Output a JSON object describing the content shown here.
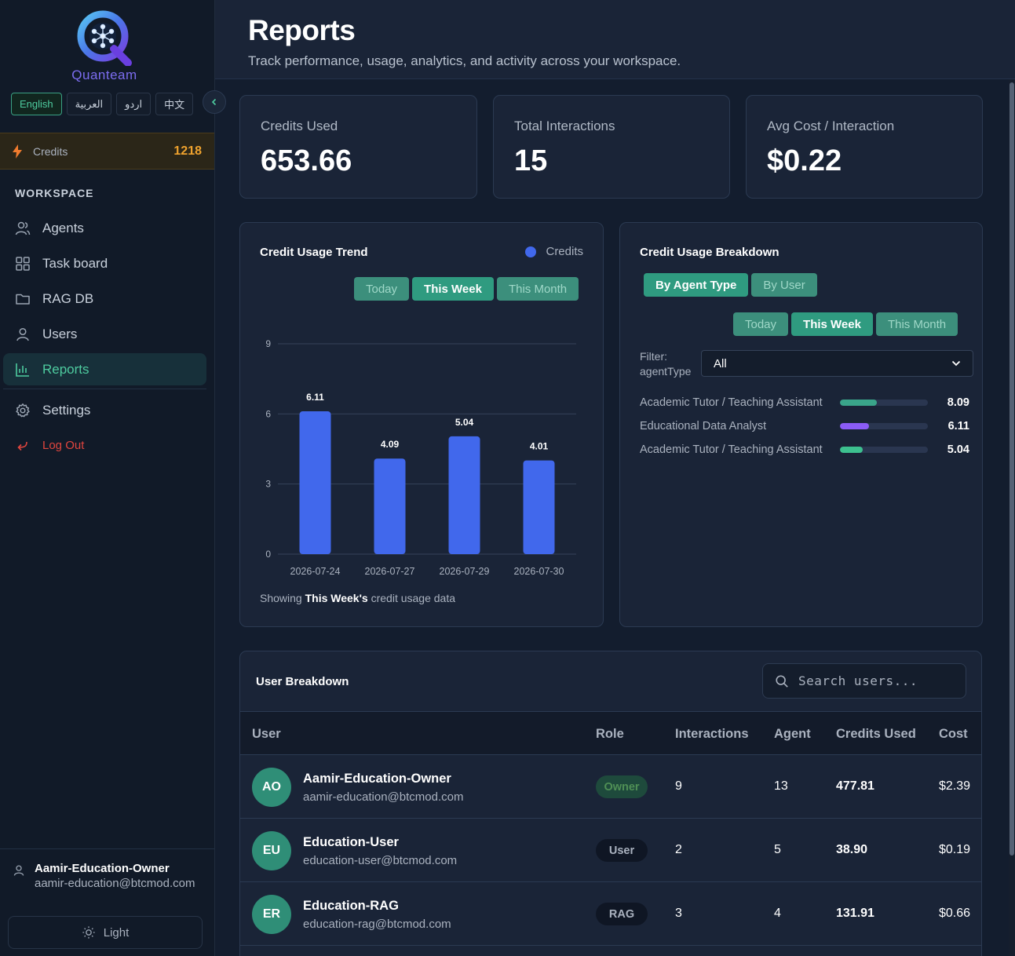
{
  "brand": {
    "name": "Quanteam"
  },
  "languages": [
    {
      "label": "English",
      "active": true
    },
    {
      "label": "العربية",
      "active": false
    },
    {
      "label": "اردو",
      "active": false
    },
    {
      "label": "中文",
      "active": false
    }
  ],
  "credits": {
    "label": "Credits",
    "value": "1218"
  },
  "sidebar": {
    "section": "WORKSPACE",
    "items": [
      {
        "label": "Agents",
        "icon": "users-icon"
      },
      {
        "label": "Task board",
        "icon": "grid-icon"
      },
      {
        "label": "RAG DB",
        "icon": "folder-icon"
      },
      {
        "label": "Users",
        "icon": "user-icon"
      },
      {
        "label": "Reports",
        "icon": "bar-chart-icon",
        "active": true
      }
    ],
    "settings": "Settings",
    "logout": "Log Out"
  },
  "current_user": {
    "name": "Aamir-Education-Owner",
    "email": "aamir-education@btcmod.com"
  },
  "theme_toggle": "Light",
  "header": {
    "title": "Reports",
    "subtitle": "Track performance, usage, analytics, and activity across your workspace."
  },
  "stats": [
    {
      "label": "Credits Used",
      "value": "653.66"
    },
    {
      "label": "Total Interactions",
      "value": "15"
    },
    {
      "label": "Avg Cost / Interaction",
      "value": "$0.22"
    }
  ],
  "trend": {
    "title": "Credit Usage Trend",
    "legend": "Credits",
    "periods": [
      "Today",
      "This Week",
      "This Month"
    ],
    "active_period": "This Week",
    "footer_prefix": "Showing",
    "footer_period": "This Week's",
    "footer_suffix": "credit usage data"
  },
  "chart_data": {
    "type": "bar",
    "categories": [
      "2026-07-24",
      "2026-07-27",
      "2026-07-29",
      "2026-07-30"
    ],
    "series": [
      {
        "name": "Credits",
        "values": [
          6.11,
          4.09,
          5.04,
          4.01
        ]
      }
    ],
    "value_labels": [
      "6.11",
      "4.09",
      "5.04",
      "4.01"
    ],
    "yticks": [
      0,
      3,
      6,
      9
    ],
    "ylim": [
      0,
      9
    ],
    "grid": true,
    "legend": "top-right",
    "bar_color": "#4168ec"
  },
  "breakdown": {
    "title": "Credit Usage Breakdown",
    "tabs": [
      "By Agent Type",
      "By User"
    ],
    "periods": [
      "Today",
      "This Week",
      "This Month"
    ],
    "filter_label": "Filter:",
    "filter_field": "agentType",
    "filter_value": "All",
    "rows": [
      {
        "name": "Academic Tutor / Teaching Assistant",
        "value": "8.09",
        "fraction": 0.42,
        "color": "#3aa58a"
      },
      {
        "name": "Educational Data Analyst",
        "value": "6.11",
        "fraction": 0.33,
        "color": "#8b5cf6"
      },
      {
        "name": "Academic Tutor / Teaching Assistant",
        "value": "5.04",
        "fraction": 0.26,
        "color": "#3dc08f"
      }
    ]
  },
  "user_table": {
    "title": "User Breakdown",
    "search_placeholder": "Search users...",
    "columns": [
      "User",
      "Role",
      "Interactions",
      "Agent",
      "Credits Used",
      "Cost"
    ],
    "rows": [
      {
        "initials": "AO",
        "name": "Aamir-Education-Owner",
        "email": "aamir-education@btcmod.com",
        "role": "Owner",
        "interactions": "9",
        "agent": "13",
        "credits": "477.81",
        "cost": "$2.39"
      },
      {
        "initials": "EU",
        "name": "Education-User",
        "email": "education-user@btcmod.com",
        "role": "User",
        "interactions": "2",
        "agent": "5",
        "credits": "38.90",
        "cost": "$0.19"
      },
      {
        "initials": "ER",
        "name": "Education-RAG",
        "email": "education-rag@btcmod.com",
        "role": "RAG",
        "interactions": "3",
        "agent": "4",
        "credits": "131.91",
        "cost": "$0.66"
      }
    ]
  }
}
